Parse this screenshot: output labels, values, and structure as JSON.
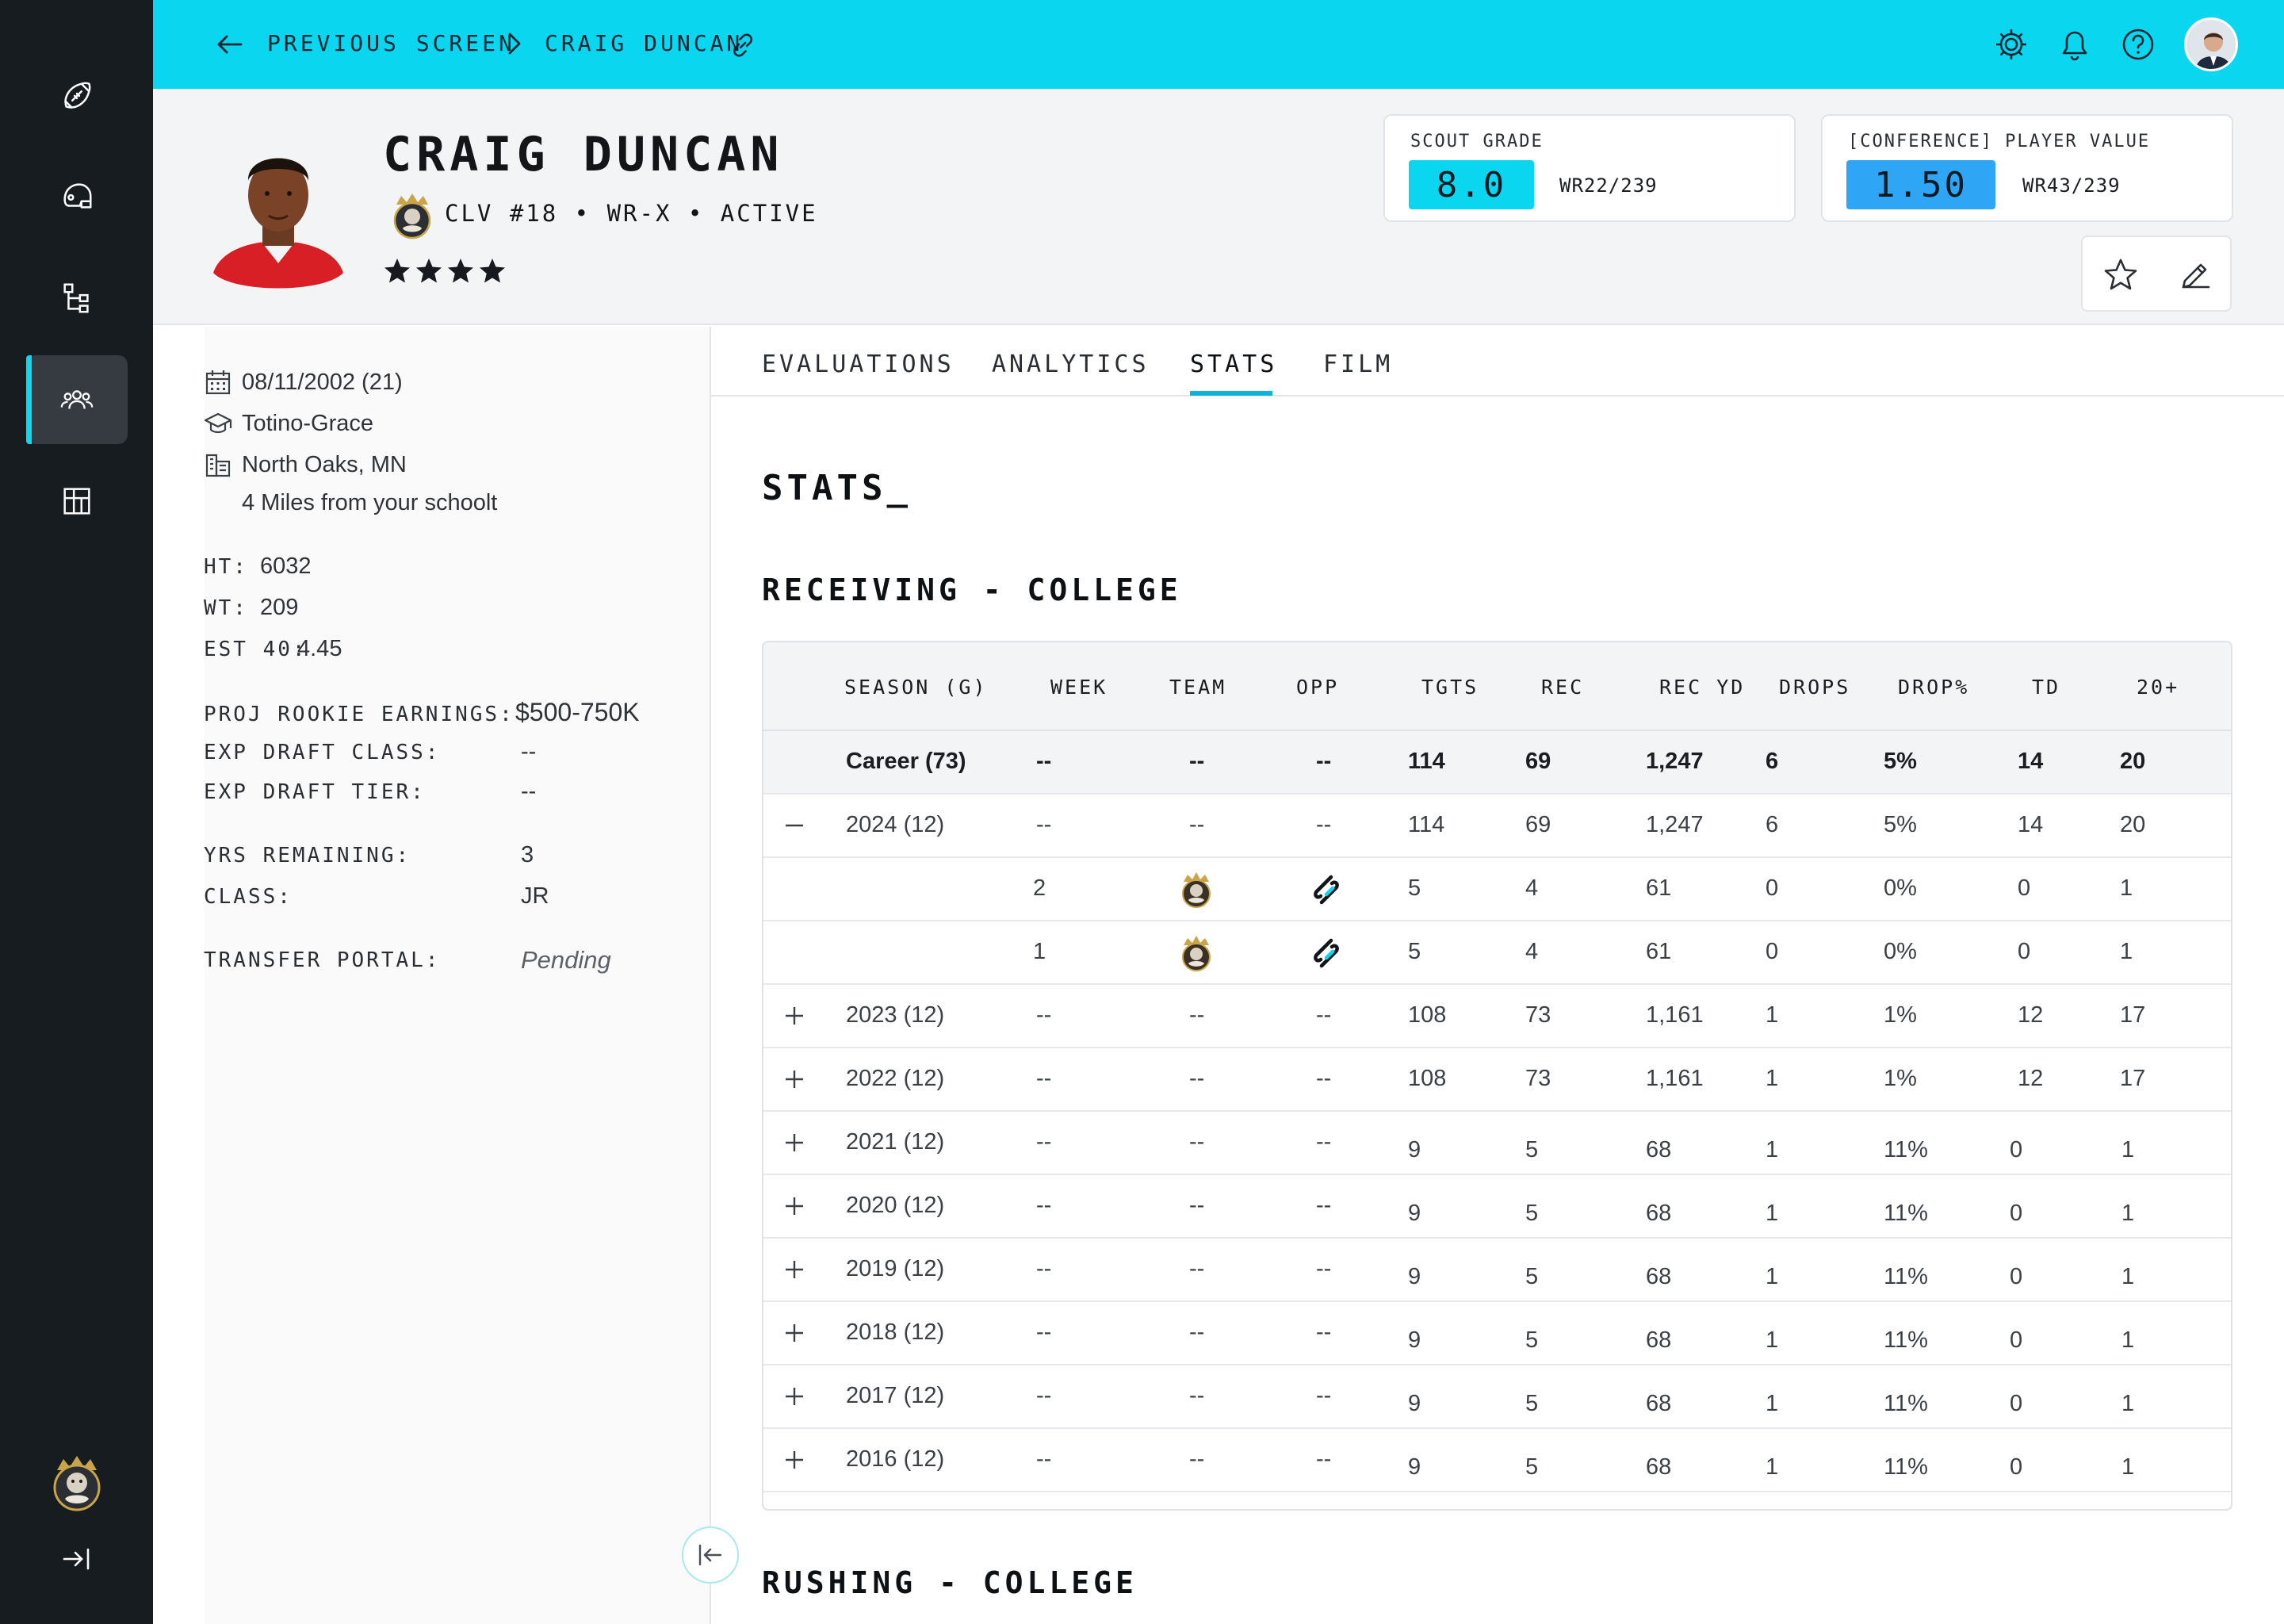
{
  "topbar": {
    "back_label": "PREVIOUS SCREEN",
    "current_label": "CRAIG DUNCAN"
  },
  "player": {
    "name": "CRAIG DUNCAN",
    "meta": "CLV #18 • WR-X • ACTIVE",
    "stars": 4
  },
  "scout_grade": {
    "label": "SCOUT GRADE",
    "value": "8.0",
    "rank": "WR22/239",
    "color": "#0ad6f0"
  },
  "player_value": {
    "label": "[CONFERENCE] PLAYER VALUE",
    "value": "1.50",
    "rank": "WR43/239",
    "color": "#2fa6f5"
  },
  "info": {
    "dob": "08/11/2002 (21)",
    "school": "Totino-Grace",
    "location": "North Oaks, MN",
    "distance": "4 Miles from your schoolt",
    "ht_label": "HT:",
    "ht": "6032",
    "wt_label": "WT:",
    "wt": "209",
    "est40_label": "EST 40:",
    "est40": "4.45",
    "proj_label": "PROJ ROOKIE EARNINGS:",
    "proj": "$500-750K",
    "draft_class_label": "EXP DRAFT CLASS:",
    "draft_class": "--",
    "draft_tier_label": "EXP DRAFT TIER:",
    "draft_tier": "--",
    "yrs_label": "YRS REMAINING:",
    "yrs": "3",
    "class_label": "CLASS:",
    "class": "JR",
    "portal_label": "TRANSFER PORTAL:",
    "portal": "Pending"
  },
  "tabs": [
    "EVALUATIONS",
    "ANALYTICS",
    "STATS",
    "FILM"
  ],
  "active_tab": "STATS",
  "main": {
    "title": "STATS_",
    "receiving_title": "RECEIVING - COLLEGE",
    "rushing_title": "RUSHING - COLLEGE"
  },
  "table": {
    "headers": [
      "SEASON (G)",
      "WEEK",
      "TEAM",
      "OPP",
      "TGTS",
      "REC",
      "REC YD",
      "DROPS",
      "DROP%",
      "TD",
      "20+"
    ],
    "rows": [
      {
        "type": "career",
        "season": "Career (73)",
        "week": "--",
        "team": "--",
        "opp": "--",
        "tgts": "114",
        "rec": "69",
        "rec_yd": "1,247",
        "drops": "6",
        "drop_pct": "5%",
        "td": "14",
        "plus20": "20"
      },
      {
        "type": "season",
        "expander": "minus",
        "season": "2024 (12)",
        "week": "--",
        "team": "--",
        "opp": "--",
        "tgts": "114",
        "rec": "69",
        "rec_yd": "1,247",
        "drops": "6",
        "drop_pct": "5%",
        "td": "14",
        "plus20": "20"
      },
      {
        "type": "week",
        "season": "",
        "week": "2",
        "team": "team-logo",
        "opp": "opponent-logo",
        "tgts": "5",
        "rec": "4",
        "rec_yd": "61",
        "drops": "0",
        "drop_pct": "0%",
        "td": "0",
        "plus20": "1"
      },
      {
        "type": "week",
        "season": "",
        "week": "1",
        "team": "team-logo",
        "opp": "opponent-logo",
        "tgts": "5",
        "rec": "4",
        "rec_yd": "61",
        "drops": "0",
        "drop_pct": "0%",
        "td": "0",
        "plus20": "1"
      },
      {
        "type": "season",
        "expander": "plus",
        "season": "2023 (12)",
        "week": "--",
        "team": "--",
        "opp": "--",
        "tgts": "108",
        "rec": "73",
        "rec_yd": "1,161",
        "drops": "1",
        "drop_pct": "1%",
        "td": "12",
        "plus20": "17"
      },
      {
        "type": "season",
        "expander": "plus",
        "season": "2022 (12)",
        "week": "--",
        "team": "--",
        "opp": "--",
        "tgts": "108",
        "rec": "73",
        "rec_yd": "1,161",
        "drops": "1",
        "drop_pct": "1%",
        "td": "12",
        "plus20": "17"
      },
      {
        "type": "season",
        "expander": "plus",
        "season": "2021 (12)",
        "week": "--",
        "team": "--",
        "opp": "--",
        "tgts": "9",
        "rec": "5",
        "rec_yd": "68",
        "drops": "1",
        "drop_pct": "11%",
        "td": "0",
        "plus20": "1"
      },
      {
        "type": "season",
        "expander": "plus",
        "season": "2020 (12)",
        "week": "--",
        "team": "--",
        "opp": "--",
        "tgts": "9",
        "rec": "5",
        "rec_yd": "68",
        "drops": "1",
        "drop_pct": "11%",
        "td": "0",
        "plus20": "1"
      },
      {
        "type": "season",
        "expander": "plus",
        "season": "2019 (12)",
        "week": "--",
        "team": "--",
        "opp": "--",
        "tgts": "9",
        "rec": "5",
        "rec_yd": "68",
        "drops": "1",
        "drop_pct": "11%",
        "td": "0",
        "plus20": "1"
      },
      {
        "type": "season",
        "expander": "plus",
        "season": "2018 (12)",
        "week": "--",
        "team": "--",
        "opp": "--",
        "tgts": "9",
        "rec": "5",
        "rec_yd": "68",
        "drops": "1",
        "drop_pct": "11%",
        "td": "0",
        "plus20": "1"
      },
      {
        "type": "season",
        "expander": "plus",
        "season": "2017 (12)",
        "week": "--",
        "team": "--",
        "opp": "--",
        "tgts": "9",
        "rec": "5",
        "rec_yd": "68",
        "drops": "1",
        "drop_pct": "11%",
        "td": "0",
        "plus20": "1"
      },
      {
        "type": "season",
        "expander": "plus",
        "season": "2016 (12)",
        "week": "--",
        "team": "--",
        "opp": "--",
        "tgts": "9",
        "rec": "5",
        "rec_yd": "68",
        "drops": "1",
        "drop_pct": "11%",
        "td": "0",
        "plus20": "1"
      }
    ]
  },
  "icons": {
    "rail": [
      "football-icon",
      "helmet-icon",
      "hierarchy-icon",
      "users-icon",
      "board-icon"
    ],
    "top": [
      "settings-icon",
      "bell-icon",
      "help-icon"
    ]
  },
  "colors": {
    "accent": "#0ad6f0",
    "rail_bg": "#171c20",
    "tab_active": "#0fb3d8"
  }
}
